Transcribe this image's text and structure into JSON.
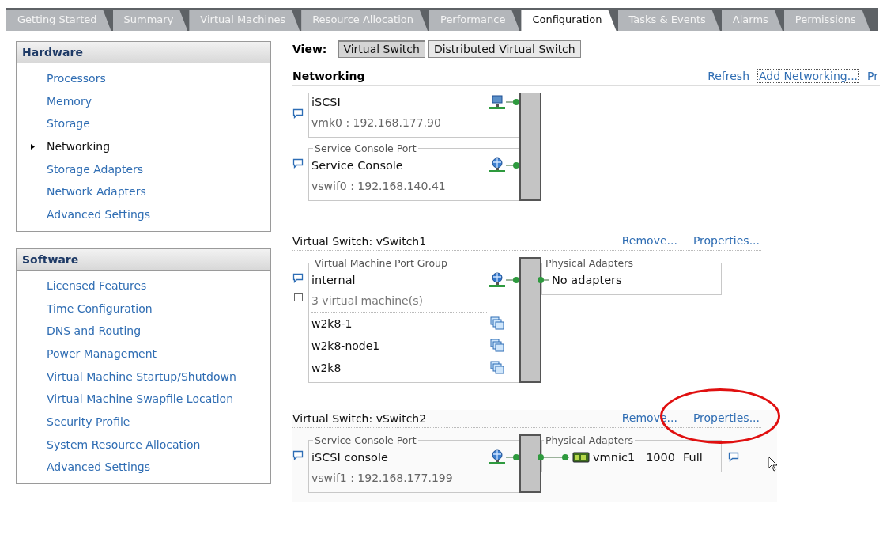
{
  "tabs": [
    {
      "label": "Getting Started",
      "selected": false
    },
    {
      "label": "Summary",
      "selected": false
    },
    {
      "label": "Virtual Machines",
      "selected": false
    },
    {
      "label": "Resource Allocation",
      "selected": false
    },
    {
      "label": "Performance",
      "selected": false
    },
    {
      "label": "Configuration",
      "selected": true
    },
    {
      "label": "Tasks & Events",
      "selected": false
    },
    {
      "label": "Alarms",
      "selected": false
    },
    {
      "label": "Permissions",
      "selected": false
    }
  ],
  "sidebar": [
    {
      "title": "Hardware",
      "items": [
        {
          "label": "Processors",
          "selected": false
        },
        {
          "label": "Memory",
          "selected": false
        },
        {
          "label": "Storage",
          "selected": false
        },
        {
          "label": "Networking",
          "selected": true
        },
        {
          "label": "Storage Adapters",
          "selected": false
        },
        {
          "label": "Network Adapters",
          "selected": false
        },
        {
          "label": "Advanced Settings",
          "selected": false
        }
      ]
    },
    {
      "title": "Software",
      "items": [
        {
          "label": "Licensed Features",
          "selected": false
        },
        {
          "label": "Time Configuration",
          "selected": false
        },
        {
          "label": "DNS and Routing",
          "selected": false
        },
        {
          "label": "Power Management",
          "selected": false
        },
        {
          "label": "Virtual Machine Startup/Shutdown",
          "selected": false
        },
        {
          "label": "Virtual Machine Swapfile Location",
          "selected": false
        },
        {
          "label": "Security Profile",
          "selected": false
        },
        {
          "label": "System Resource Allocation",
          "selected": false
        },
        {
          "label": "Advanced Settings",
          "selected": false
        }
      ]
    }
  ],
  "view": {
    "label": "View:",
    "options": [
      {
        "label": "Virtual Switch",
        "selected": true
      },
      {
        "label": "Distributed Virtual Switch",
        "selected": false
      }
    ]
  },
  "networking": {
    "title": "Networking",
    "links": [
      {
        "label": "Refresh",
        "focused": false
      },
      {
        "label": "Add Networking...",
        "focused": true
      },
      {
        "label": "Pr",
        "focused": false
      }
    ]
  },
  "switches": [
    {
      "port_groups": [
        {
          "kind": "vmkernel",
          "name": "iSCSI",
          "detail": "vmk0 : 192.168.177.90"
        },
        {
          "kind": "console",
          "group_label": "Service Console Port",
          "name": "Service Console",
          "detail": "vswif0 : 192.168.140.41"
        }
      ]
    },
    {
      "title": "Virtual Switch: vSwitch1",
      "actions": [
        {
          "label": "Remove...",
          "highlighted": false
        },
        {
          "label": "Properties...",
          "highlighted": false
        }
      ],
      "port_groups": [
        {
          "kind": "vm",
          "group_label": "Virtual Machine Port Group",
          "name": "internal",
          "vm_count": "3 virtual machine(s)",
          "expanded": true,
          "vms": [
            "w2k8-1",
            "w2k8-node1",
            "w2k8"
          ]
        }
      ],
      "physical_adapters": {
        "label": "Physical Adapters",
        "empty_text": "No adapters"
      }
    },
    {
      "title": "Virtual Switch: vSwitch2",
      "actions": [
        {
          "label": "Remove...",
          "highlighted": false
        },
        {
          "label": "Properties...",
          "highlighted": true
        }
      ],
      "port_groups": [
        {
          "kind": "console",
          "group_label": "Service Console Port",
          "name": "iSCSI console",
          "detail": "vswif1 : 192.168.177.199"
        }
      ],
      "physical_adapters": {
        "label": "Physical Adapters",
        "adapters": [
          {
            "name": "vmnic1",
            "speed": "1000",
            "duplex": "Full"
          }
        ]
      }
    }
  ]
}
